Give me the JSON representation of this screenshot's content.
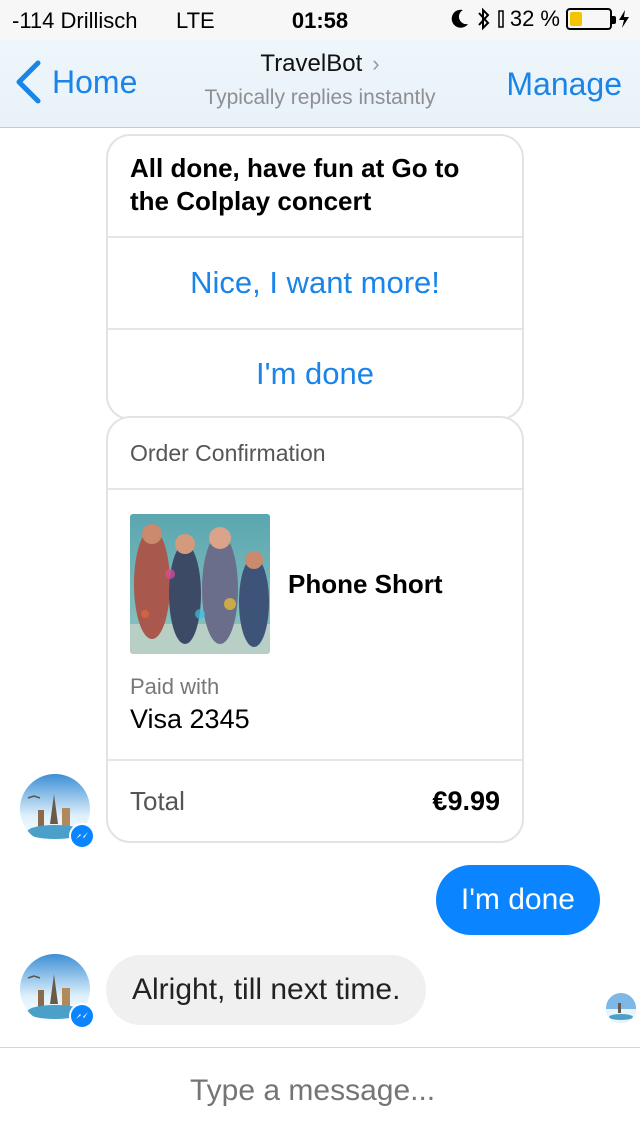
{
  "status_bar": {
    "carrier": "-114 Drillisch",
    "network": "LTE",
    "time": "01:58",
    "battery_text": "32 %",
    "battery_level": 0.32
  },
  "nav": {
    "back_label": "Home",
    "title": "TravelBot",
    "subtitle": "Typically replies instantly",
    "manage_label": "Manage"
  },
  "messages": {
    "card_text": "All done, have fun at Go to the Colplay concert",
    "quick_replies": [
      "Nice, I want more!",
      "I'm done"
    ],
    "receipt": {
      "header": "Order Confirmation",
      "item_name": "Phone Short",
      "paid_label": "Paid with",
      "paid_value": "Visa 2345",
      "total_label": "Total",
      "total_value": "€9.99"
    },
    "user_reply": "I'm done",
    "bot_reply": "Alright, till next time."
  },
  "composer": {
    "placeholder": "Type a message..."
  },
  "colors": {
    "accent": "#1a84e8",
    "outgoing_bubble": "#0a84ff",
    "incoming_bubble": "#f0f0f0",
    "battery_fill": "#f5c400"
  },
  "icons": {
    "back": "chevron-left-icon",
    "title_chevron": "chevron-right-icon",
    "moon": "moon-icon",
    "bluetooth": "bluetooth-icon",
    "charging": "bolt-icon",
    "messenger_badge": "messenger-icon"
  }
}
